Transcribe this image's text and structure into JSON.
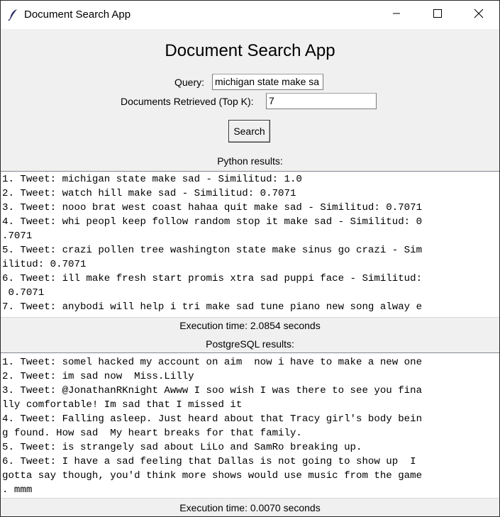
{
  "window": {
    "title": "Document Search App"
  },
  "app": {
    "heading": "Document Search App",
    "query_label": "Query:",
    "query_value": "michigan state make sa",
    "topk_label": "Documents Retrieved (Top K):",
    "topk_value": "7",
    "search_label": "Search"
  },
  "python": {
    "label": "Python results:",
    "lines": [
      "1. Tweet: michigan state make sad - Similitud: 1.0",
      "2. Tweet: watch hill make sad - Similitud: 0.7071",
      "3. Tweet: nooo brat west coast hahaa quit make sad - Similitud: 0.7071",
      "4. Tweet: whi peopl keep follow random stop it make sad - Similitud: 0",
      ".7071",
      "5. Tweet: crazi pollen tree washington state make sinus go crazi - Sim",
      "ilitud: 0.7071",
      "6. Tweet: ill make fresh start promis xtra sad puppi face - Similitud:",
      " 0.7071",
      "7. Tweet: anybodi will help i tri make sad tune piano new song alway e"
    ],
    "execution_time": "Execution time: 2.0854 seconds"
  },
  "postgres": {
    "label": "PostgreSQL results:",
    "lines": [
      "1. Tweet: somel hacked my account on aim  now i have to make a new one",
      "2. Tweet: im sad now  Miss.Lilly",
      "3. Tweet: @JonathanRKnight Awww I soo wish I was there to see you fina",
      "lly comfortable! Im sad that I missed it",
      "4. Tweet: Falling asleep. Just heard about that Tracy girl's body bein",
      "g found. How sad  My heart breaks for that family.",
      "5. Tweet: is strangely sad about LiLo and SamRo breaking up.",
      "6. Tweet: I have a sad feeling that Dallas is not going to show up  I",
      "gotta say though, you'd think more shows would use music from the game",
      ". mmm"
    ],
    "execution_time": "Execution time: 0.0070 seconds"
  },
  "icons": {
    "app": "feather-icon",
    "minimize": "minimize-icon",
    "maximize": "maximize-icon",
    "close": "close-icon"
  }
}
